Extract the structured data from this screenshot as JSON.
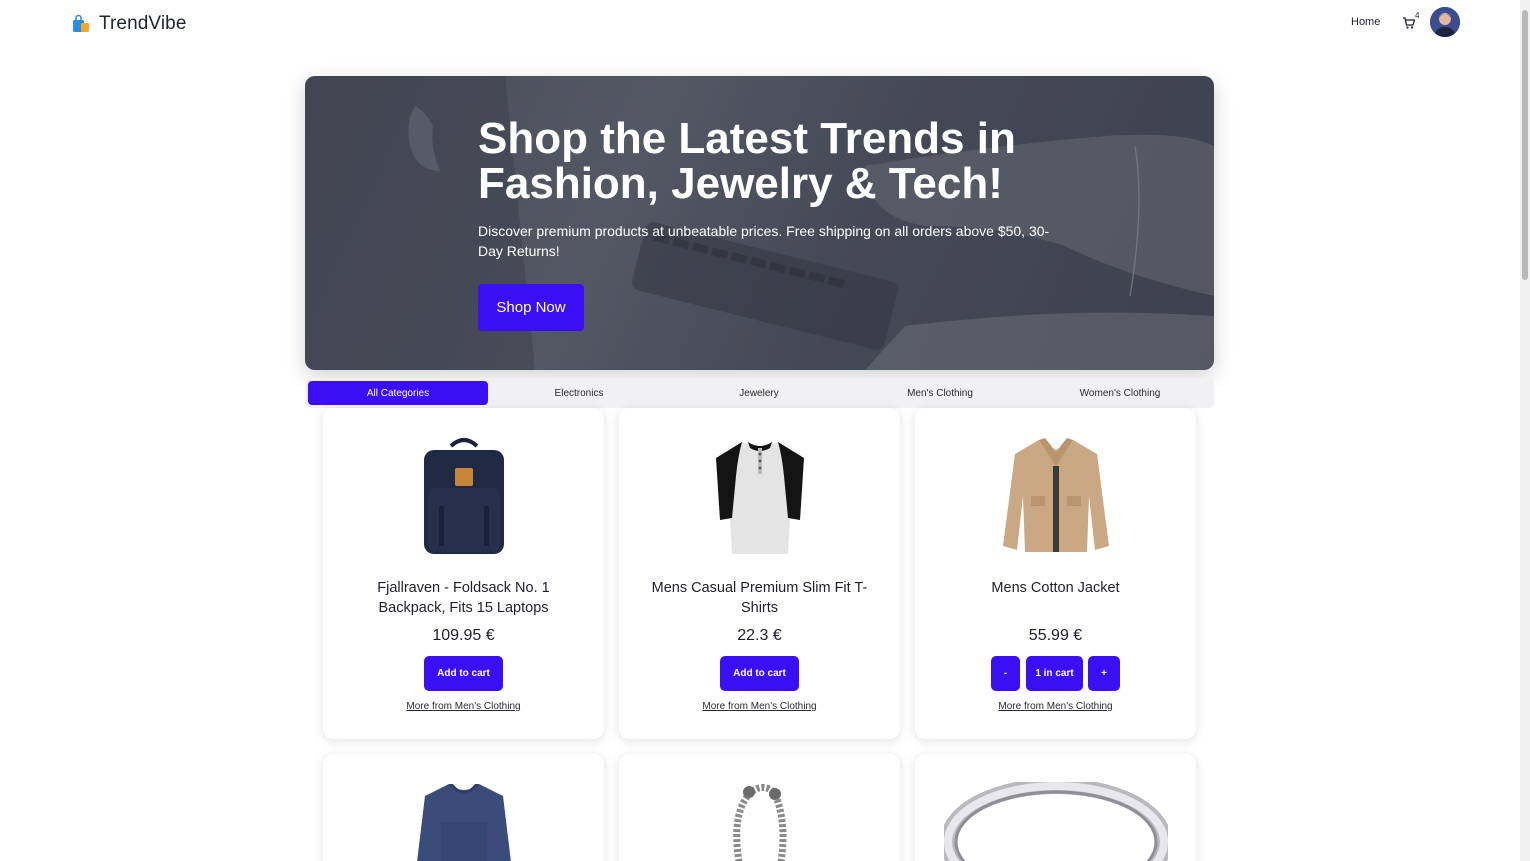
{
  "brand": {
    "name": "TrendVibe",
    "logo_icon": "shopping-bag-icon"
  },
  "nav": {
    "home_label": "Home",
    "cart_count": "4",
    "cart_icon": "cart-icon"
  },
  "hero": {
    "title": "Shop the Latest Trends in Fashion, Jewelry & Tech!",
    "subtitle": "Discover premium products at unbeatable prices. Free shipping on all orders above $50, 30-Day Returns!",
    "cta_label": "Shop Now"
  },
  "categories": [
    {
      "label": "All Categories",
      "active": true
    },
    {
      "label": "Electronics",
      "active": false
    },
    {
      "label": "Jewelery",
      "active": false
    },
    {
      "label": "Men's Clothing",
      "active": false
    },
    {
      "label": "Women's Clothing",
      "active": false
    }
  ],
  "products": [
    {
      "title": "Fjallraven - Foldsack No. 1 Backpack, Fits 15 Laptops",
      "price": "109.95 €",
      "action": "Add to cart",
      "link": "More from Men's Clothing",
      "image_icon": "backpack-icon"
    },
    {
      "title": "Mens Casual Premium Slim Fit T-Shirts",
      "price": "22.3 €",
      "action": "Add to cart",
      "link": "More from Men's Clothing",
      "image_icon": "tshirt-icon"
    },
    {
      "title": "Mens Cotton Jacket",
      "price": "55.99 €",
      "decrement": "-",
      "in_cart": "1 in cart",
      "increment": "+",
      "link": "More from Men's Clothing",
      "image_icon": "jacket-icon"
    },
    {
      "image_icon": "sweater-icon"
    },
    {
      "image_icon": "bracelet-icon"
    },
    {
      "image_icon": "ring-icon"
    }
  ],
  "colors": {
    "accent": "#3a0ff5",
    "text": "#1f1f2e"
  }
}
